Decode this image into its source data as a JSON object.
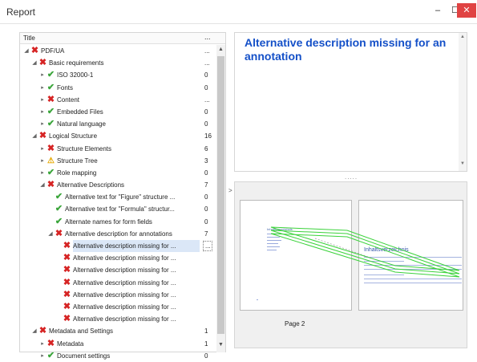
{
  "window": {
    "title": "Report",
    "min_glyph": "–",
    "max_glyph": "☐",
    "close_glyph": "✕"
  },
  "tree": {
    "col_title": "Title",
    "col_more": "...",
    "rows": [
      {
        "label": "PDF/UA",
        "count": "...",
        "level": 0,
        "status": "x",
        "expanded": true
      },
      {
        "label": "Basic requirements",
        "count": "...",
        "level": 1,
        "status": "x",
        "expanded": true
      },
      {
        "label": "ISO 32000-1",
        "count": "0",
        "level": 2,
        "status": "ok",
        "expanded": false
      },
      {
        "label": "Fonts",
        "count": "0",
        "level": 2,
        "status": "ok",
        "expanded": false
      },
      {
        "label": "Content",
        "count": "...",
        "level": 2,
        "status": "x",
        "expanded": false
      },
      {
        "label": "Embedded Files",
        "count": "0",
        "level": 2,
        "status": "ok",
        "expanded": false
      },
      {
        "label": "Natural language",
        "count": "0",
        "level": 2,
        "status": "ok",
        "expanded": false
      },
      {
        "label": "Logical Structure",
        "count": "16",
        "level": 1,
        "status": "x",
        "expanded": true
      },
      {
        "label": "Structure Elements",
        "count": "6",
        "level": 2,
        "status": "x",
        "expanded": false
      },
      {
        "label": "Structure Tree",
        "count": "3",
        "level": 2,
        "status": "warn",
        "expanded": false
      },
      {
        "label": "Role mapping",
        "count": "0",
        "level": 2,
        "status": "ok",
        "expanded": false
      },
      {
        "label": "Alternative Descriptions",
        "count": "7",
        "level": 2,
        "status": "x",
        "expanded": true
      },
      {
        "label": "Alternative text for \"Figure\" structure ...",
        "count": "0",
        "level": 3,
        "status": "ok",
        "expanded": null
      },
      {
        "label": "Alternative text for \"Formula\" structur...",
        "count": "0",
        "level": 3,
        "status": "ok",
        "expanded": null
      },
      {
        "label": "Alternate names for form fields",
        "count": "0",
        "level": 3,
        "status": "ok",
        "expanded": null
      },
      {
        "label": "Alternative description for annotations",
        "count": "7",
        "level": 3,
        "status": "x",
        "expanded": true
      },
      {
        "label": "Alternative description missing for ...",
        "count": "",
        "level": 4,
        "status": "x",
        "expanded": null,
        "selected": true
      },
      {
        "label": "Alternative description missing for ...",
        "count": "",
        "level": 4,
        "status": "x",
        "expanded": null
      },
      {
        "label": "Alternative description missing for ...",
        "count": "",
        "level": 4,
        "status": "x",
        "expanded": null
      },
      {
        "label": "Alternative description missing for ...",
        "count": "",
        "level": 4,
        "status": "x",
        "expanded": null
      },
      {
        "label": "Alternative description missing for ...",
        "count": "",
        "level": 4,
        "status": "x",
        "expanded": null
      },
      {
        "label": "Alternative description missing for ...",
        "count": "",
        "level": 4,
        "status": "x",
        "expanded": null
      },
      {
        "label": "Alternative description missing for ...",
        "count": "",
        "level": 4,
        "status": "x",
        "expanded": null
      },
      {
        "label": "Metadata and Settings",
        "count": "1",
        "level": 1,
        "status": "x",
        "expanded": true
      },
      {
        "label": "Metadata",
        "count": "1",
        "level": 2,
        "status": "x",
        "expanded": false
      },
      {
        "label": "Document settings",
        "count": "0",
        "level": 2,
        "status": "ok",
        "expanded": false
      }
    ],
    "selected_count": "..."
  },
  "detail": {
    "heading": "Alternative description missing for an annotation"
  },
  "preview": {
    "page_label": "Page 2",
    "left_page_heading": "Inhaltsverzeichnis",
    "right_page_heading": "Inhaltsverzeichnis"
  },
  "colors": {
    "error": "#d62424",
    "ok": "#3aa53a",
    "warning": "#e6a800",
    "heading": "#1450c8"
  }
}
